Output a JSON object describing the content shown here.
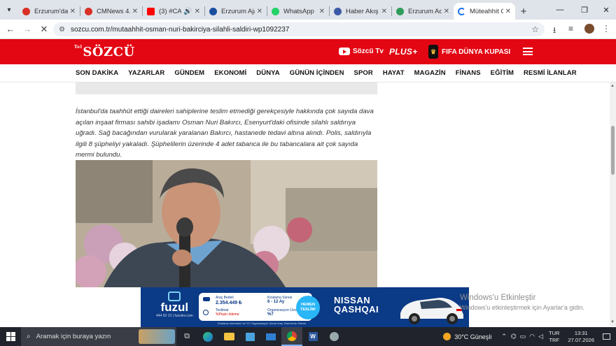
{
  "browser": {
    "tabs": [
      {
        "title": "Erzurum'da C",
        "color": "#d93025"
      },
      {
        "title": "CMNews 4.0",
        "color": "#d93025"
      },
      {
        "title": "(3) #CAN",
        "color": "#ff0000"
      },
      {
        "title": "Erzurum Ajan",
        "color": "#1a4fa0"
      },
      {
        "title": "WhatsApp",
        "color": "#25d366"
      },
      {
        "title": "Haber Akış S",
        "color": "#3b5aa6"
      },
      {
        "title": "Erzurum Adli",
        "color": "#2e9d5a"
      },
      {
        "title": "Müteahhit O",
        "color": "#1a73e8"
      }
    ],
    "url": "sozcu.com.tr/mutaahhit-osman-nuri-bakirciya-silahli-saldiri-wp1092237"
  },
  "site": {
    "logo_text": "SÖZCÜ",
    "logo_small": "Tel",
    "sozcu_tv": "Sözcü Tv",
    "plus": "PLUS+",
    "fifa": "FIFA DÜNYA KUPASI",
    "menu": [
      "SON DAKİKA",
      "YAZARLAR",
      "GÜNDEM",
      "EKONOMİ",
      "DÜNYA",
      "GÜNÜN İÇİNDEN",
      "SPOR",
      "HAYAT",
      "MAGAZİN",
      "FİNANS",
      "EĞİTİM",
      "RESMİ İLANLAR"
    ]
  },
  "article": {
    "text": "İstanbul'da taahhüt ettiği daireleri sahiplerine teslim etmediği gerekçesiyle hakkında çok sayıda dava açılan inşaat firması sahibi işadamı Osman Nuri Bakırcı, Esenyurt'daki ofisinde silahlı saldırıya uğradı. Sağ bacağından vurularak yaralanan Bakırcı, hastanede tedavi altına alındı. Polis, saldırıyla ilgili 8 şüpheliyi yakaladı. Şüphelilerin üzerinde 4 adet tabanca ile bu tabancalara ait çok sayıda mermi bulundu."
  },
  "ad": {
    "brand": "fuzul",
    "phone": "444 63 13",
    "site": "fuzulev.com",
    "stat1_label": "Araç Bedeli",
    "stat1_value": "2.354.449 ₺",
    "stat2_label": "Teslimat",
    "stat2_value": "%Peşin ödeme",
    "stat3_label": "Kiralama Süresi",
    "stat3_value": "6 - 12 Ay",
    "stat4_label": "Organizasyon Ücreti",
    "stat4_value": "%7",
    "badge": "HEMEN TESLİM!",
    "car_brand": "NISSAN",
    "car_model": "QASHQAI",
    "footnote": "Kiralama ödemeleri ve %7 Organizasyon Ücreti Araç Tesliminde Ödenir"
  },
  "watermark": {
    "title": "Windows'u Etkinleştir",
    "subtitle": "Windows'u etkinleştirmek için Ayarlar'a gidin."
  },
  "taskbar": {
    "search_placeholder": "Aramak için buraya yazın",
    "weather": "30°C  Güneşli",
    "lang": "TUR",
    "lang2": "TRF",
    "time": "13:31",
    "date": "27.07.2026"
  }
}
